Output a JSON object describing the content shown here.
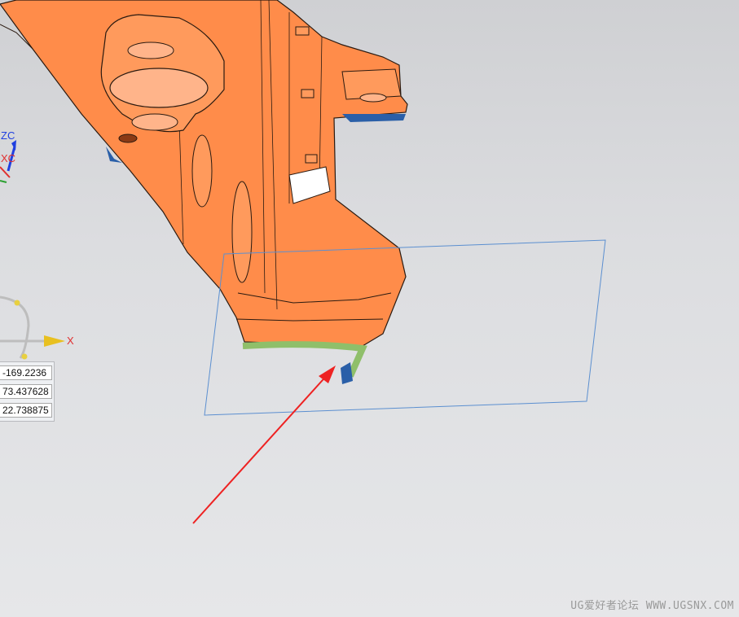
{
  "triad": {
    "zc_label": "ZC",
    "xc_label": "XC"
  },
  "manipulator": {
    "x_label": "X"
  },
  "coords": {
    "x": "-169.2236",
    "y": "73.437628",
    "z": "22.738875"
  },
  "watermark": "UG爱好者论坛 WWW.UGSNX.COM",
  "colors": {
    "part_face": "#ff8c4a",
    "part_edge": "#2a1a10",
    "selected_edge": "#8fbf6a",
    "plane_outline": "#5b8fd0",
    "arrow": "#ee2222",
    "axis_x": "#e03030",
    "axis_z": "#2040e0"
  }
}
